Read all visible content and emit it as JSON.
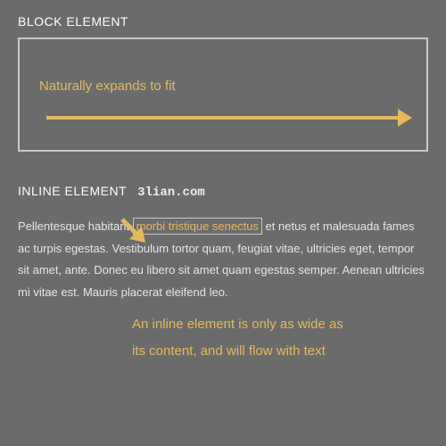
{
  "block": {
    "heading": "BLOCK ELEMENT",
    "caption": "Naturally expands to fit"
  },
  "inline": {
    "heading": "INLINE ELEMENT",
    "domain": "3lian.com",
    "para_prefix": "Pellentesque habitant ",
    "highlight": "morbi tristique senectus",
    "para_suffix": " et netus et malesuada fames ac turpis egestas. Vestibulum tortor quam, feugiat vitae, ultricies eget, tempor sit amet, ante. Donec eu libero sit amet quam egestas semper. Aenean ultricies mi vitae est. Mauris placerat eleifend leo.",
    "caption": "An inline element is only as wide as its content, and will flow with text"
  }
}
